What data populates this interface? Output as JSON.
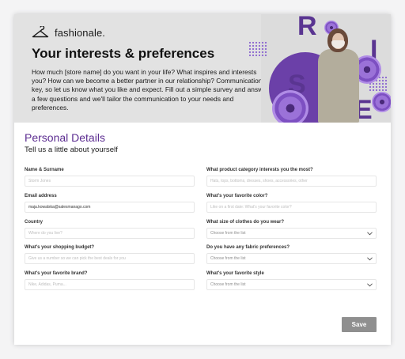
{
  "brand": {
    "name": "fashionale."
  },
  "hero": {
    "title": "Your interests & preferences",
    "text": "How much [store name] do you want in your life? What inspires and interests you? How can we become a better partner in our relationship? Communication is key, so let us know what you like and expect. Fill out a simple survey and answer a few questions and we'll tailor the communication to your needs and preferences.",
    "art_letters": [
      "R",
      "I",
      "S",
      "E"
    ]
  },
  "section": {
    "title": "Personal Details",
    "subtitle": "Tell us a little about yourself"
  },
  "left_fields": [
    {
      "label": "Name & Surname",
      "value": "",
      "placeholder": "Storm Jones"
    },
    {
      "label": "Email address",
      "value": "maja.kowalska@salesmanago.com",
      "placeholder": ""
    },
    {
      "label": "Country",
      "value": "",
      "placeholder": "Where do you live?"
    },
    {
      "label": "What's your shopping budget?",
      "value": "",
      "placeholder": "Give us a number so we can pick the best deals for you"
    },
    {
      "label": "What's your favorite brand?",
      "value": "",
      "placeholder": "Nike, Adidas, Puma..."
    }
  ],
  "right_fields": [
    {
      "label": "What product category interests you the most?",
      "value": "",
      "placeholder": "Hats, tops, bottoms, dresses, shoes, accessories, other"
    },
    {
      "label": "What's your favorite color?",
      "value": "",
      "placeholder": "Like on a first date: What's your favorite color?"
    },
    {
      "label": "What size of clothes do you wear?",
      "value": "Choose from the list",
      "type": "select"
    },
    {
      "label": "Do you have any fabric preferences?",
      "value": "Choose from the list",
      "type": "select"
    },
    {
      "label": "What's your favorite style",
      "value": "Choose from the list",
      "type": "select"
    }
  ],
  "buttons": {
    "save": "Save"
  },
  "colors": {
    "accent": "#5c2d91",
    "hero_bg": "#e2e2e2",
    "button": "#8f8f8f"
  },
  "icons": {
    "logo": "hanger-icon",
    "dropdown": "chevron-down-icon"
  }
}
